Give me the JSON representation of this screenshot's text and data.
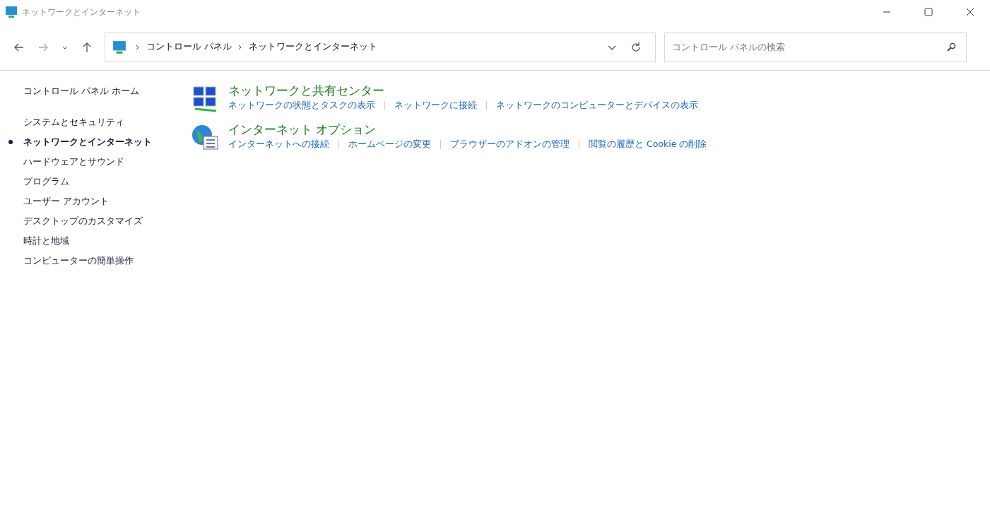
{
  "window": {
    "title": "ネットワークとインターネット"
  },
  "address_bar": {
    "breadcrumbs": [
      "コントロール パネル",
      "ネットワークとインターネット"
    ]
  },
  "search": {
    "placeholder": "コントロール パネルの検索"
  },
  "sidebar": {
    "home": "コントロール パネル ホーム",
    "items": [
      {
        "label": "システムとセキュリティ",
        "selected": false
      },
      {
        "label": "ネットワークとインターネット",
        "selected": true
      },
      {
        "label": "ハードウェアとサウンド",
        "selected": false
      },
      {
        "label": "プログラム",
        "selected": false
      },
      {
        "label": "ユーザー アカウント",
        "selected": false
      },
      {
        "label": "デスクトップのカスタマイズ",
        "selected": false
      },
      {
        "label": "時計と地域",
        "selected": false
      },
      {
        "label": "コンピューターの簡単操作",
        "selected": false
      }
    ]
  },
  "categories": [
    {
      "kind": "network",
      "title": "ネットワークと共有センター",
      "links": [
        "ネットワークの状態とタスクの表示",
        "ネットワークに接続",
        "ネットワークのコンピューターとデバイスの表示"
      ]
    },
    {
      "kind": "internet",
      "title": "インターネット オプション",
      "links": [
        "インターネットへの接続",
        "ホームページの変更",
        "ブラウザーのアドオンの管理",
        "閲覧の履歴と Cookie の削除"
      ]
    }
  ]
}
